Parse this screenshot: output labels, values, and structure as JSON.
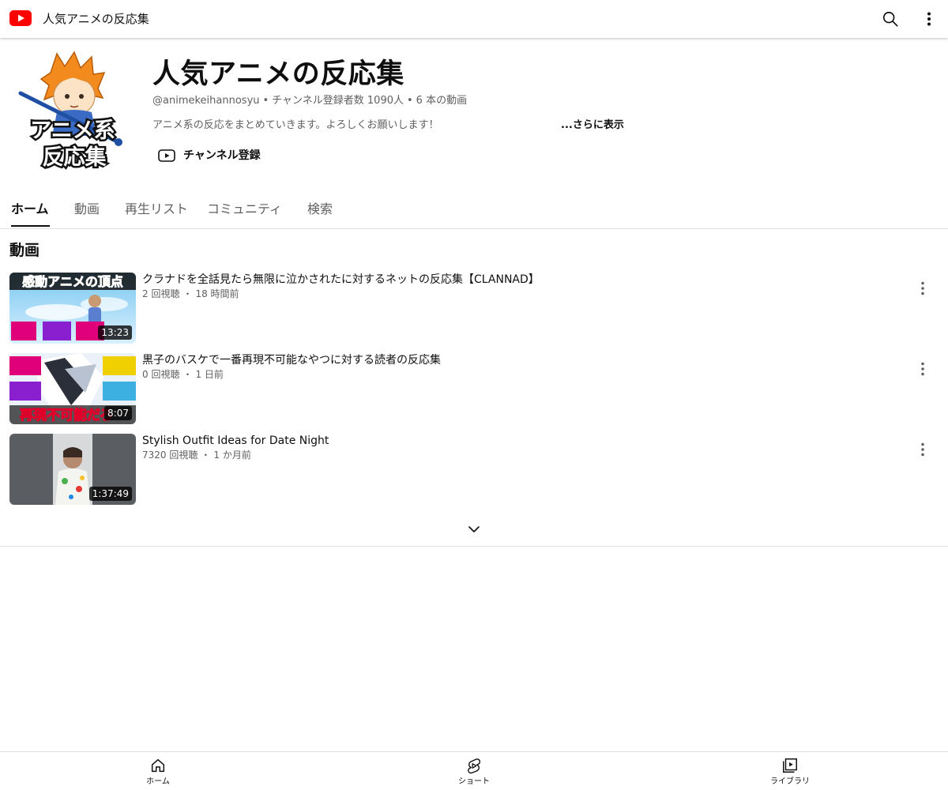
{
  "topbar": {
    "logo_icon": "youtube-logo-icon",
    "title": "人気アニメの反応集",
    "search_icon": "search-icon",
    "menu_icon": "more-vertical-icon"
  },
  "channel": {
    "name": "人気アニメの反応集",
    "handle": "@animekeihannosyu",
    "subscribers": "チャンネル登録者数 1090人",
    "video_count": "6 本の動画",
    "meta_separator": "•",
    "description": "アニメ系の反応をまとめていきます。よろしくお願いします！",
    "more_label": "...さらに表示",
    "subscribe_label": "チャンネル登録",
    "avatar_text_line1": "アニメ系",
    "avatar_text_line2": "反応集"
  },
  "tabs": [
    {
      "label": "ホーム",
      "active": true
    },
    {
      "label": "動画",
      "active": false
    },
    {
      "label": "再生リスト",
      "active": false
    },
    {
      "label": "コミュニティ",
      "active": false
    },
    {
      "label": "検索",
      "active": false
    }
  ],
  "section": {
    "title": "動画"
  },
  "videos": [
    {
      "title": "クラナドを全話見たら無限に泣かされたに対するネットの反応集【CLANNAD】",
      "views": "2 回視聴",
      "age": "18 時間前",
      "duration": "13:23",
      "thumb_text": "感動アニメの頂点"
    },
    {
      "title": "黒子のバスケで一番再現不可能なやつに対する読者の反応集",
      "views": "0 回視聴",
      "age": "1 日前",
      "duration": "8:07",
      "thumb_text": "再現不可能だろ"
    },
    {
      "title": "Stylish Outfit Ideas for Date Night",
      "views": "7320 回視聴",
      "age": "1 か月前",
      "duration": "1:37:49"
    }
  ],
  "meta_separator": "・",
  "bottom_nav": [
    {
      "label": "ホーム",
      "icon": "home-icon"
    },
    {
      "label": "ショート",
      "icon": "shorts-icon"
    },
    {
      "label": "ライブラリ",
      "icon": "library-icon"
    }
  ],
  "colors": {
    "brand_red": "#ff0000",
    "text_primary": "#0f0f0f",
    "text_secondary": "#606060",
    "divider": "#e0e0e0"
  }
}
